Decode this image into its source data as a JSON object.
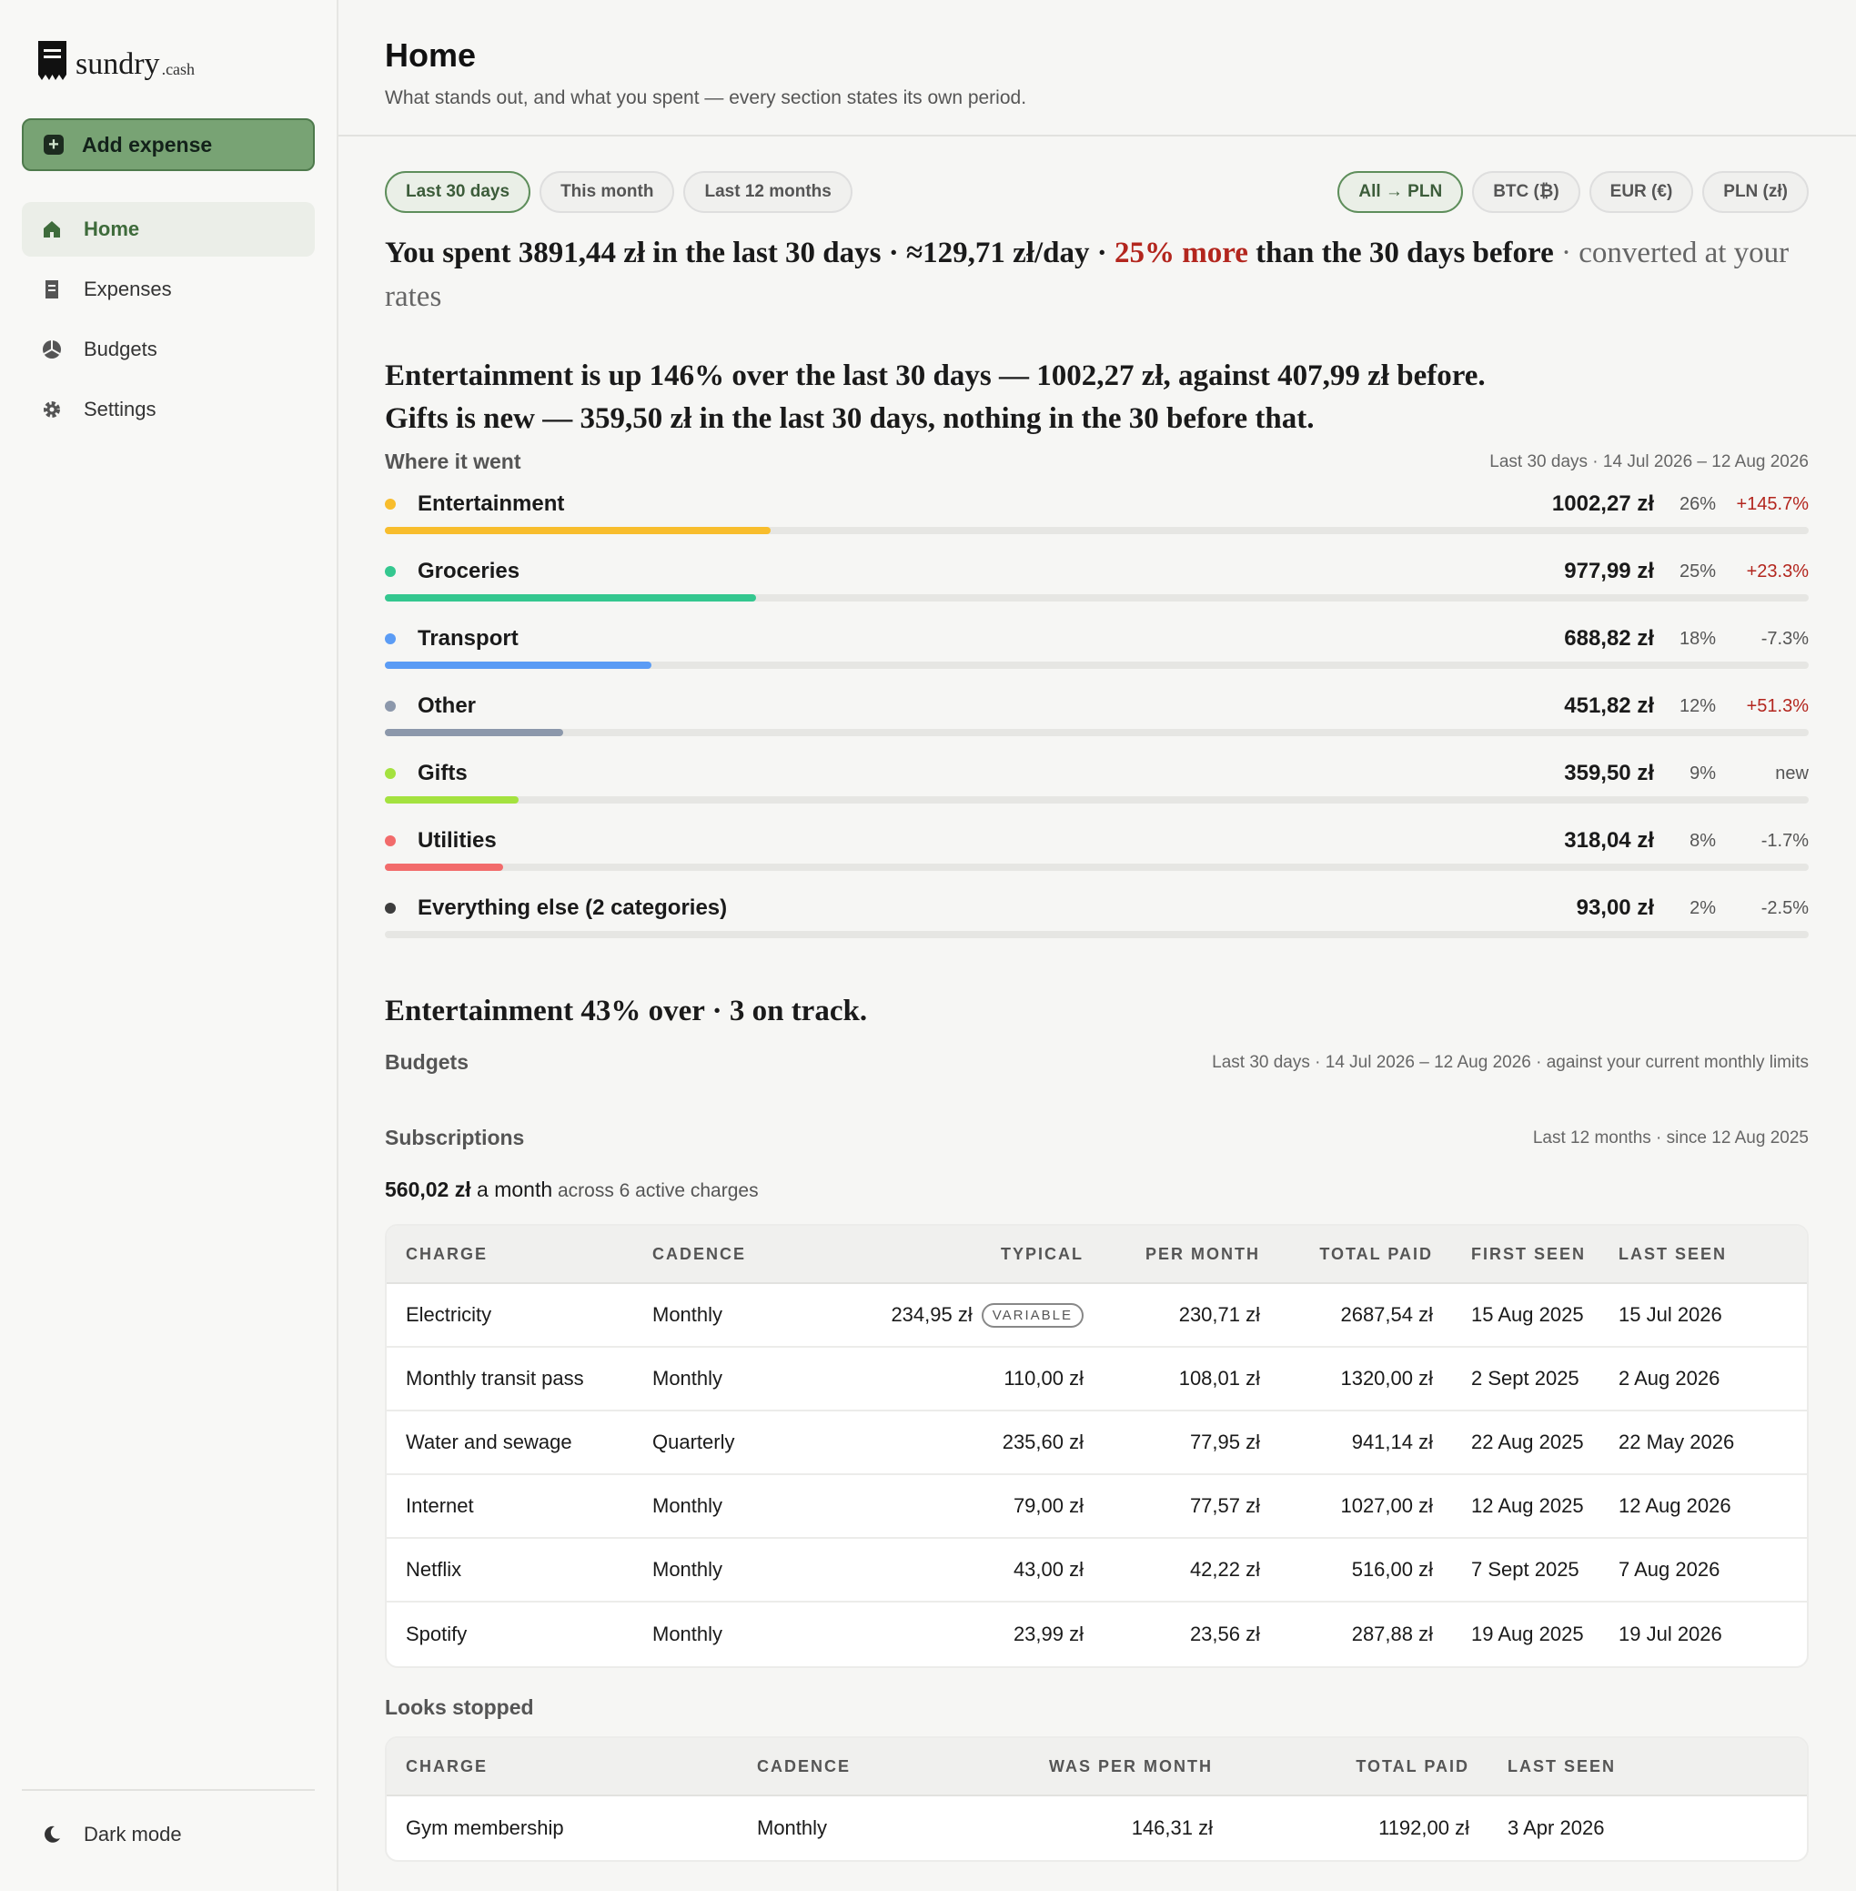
{
  "brand": {
    "name": "sundry",
    "tld": ".cash"
  },
  "sidebar": {
    "add_label": "Add expense",
    "items": [
      {
        "label": "Home",
        "icon": "home-icon"
      },
      {
        "label": "Expenses",
        "icon": "receipt-icon"
      },
      {
        "label": "Budgets",
        "icon": "pie-icon"
      },
      {
        "label": "Settings",
        "icon": "gear-icon"
      }
    ],
    "dark_mode": "Dark mode"
  },
  "header": {
    "title": "Home",
    "subtitle": "What stands out, and what you spent — every section states its own period."
  },
  "period_pills": [
    "Last 30 days",
    "This month",
    "Last 12 months"
  ],
  "currency_pills": [
    "All → PLN",
    "BTC (₿)",
    "EUR (€)",
    "PLN (zł)"
  ],
  "summary": {
    "s1": "You spent ",
    "total": "3891,44 zł",
    "s2": " in the last 30 days · ",
    "per_day": "≈129,71 zł/day",
    "s3": " · ",
    "change": "25% more",
    "s4": " than the 30 days before",
    "s5": " · converted at your rates"
  },
  "headline": {
    "line1": "Entertainment is up 146% over the last 30 days — 1002,27 zł, against 407,99 zł before.",
    "line2": "Gifts is new — 359,50 zł in the last 30 days, nothing in the 30 before that."
  },
  "where": {
    "title": "Where it went",
    "meta": "Last 30 days · 14 Jul 2026 – 12 Aug 2026",
    "categories": [
      {
        "name": "Entertainment",
        "amount": "1002,27 zł",
        "pct": "26%",
        "change": "+145.7%",
        "dir": "up",
        "color": "#f8bd2c",
        "share": 0.26
      },
      {
        "name": "Groceries",
        "amount": "977,99 zł",
        "pct": "25%",
        "change": "+23.3%",
        "dir": "up",
        "color": "#34c78f",
        "share": 0.25
      },
      {
        "name": "Transport",
        "amount": "688,82 zł",
        "pct": "18%",
        "change": "-7.3%",
        "dir": "down",
        "color": "#5b9cf5",
        "share": 0.18
      },
      {
        "name": "Other",
        "amount": "451,82 zł",
        "pct": "12%",
        "change": "+51.3%",
        "dir": "up",
        "color": "#8c98ab",
        "share": 0.12
      },
      {
        "name": "Gifts",
        "amount": "359,50 zł",
        "pct": "9%",
        "change": "new",
        "dir": "down",
        "color": "#a4e23f",
        "share": 0.09
      },
      {
        "name": "Utilities",
        "amount": "318,04 zł",
        "pct": "8%",
        "change": "-1.7%",
        "dir": "down",
        "color": "#f26b6b",
        "share": 0.08
      },
      {
        "name": "Everything else (2 categories)",
        "amount": "93,00 zł",
        "pct": "2%",
        "change": "-2.5%",
        "dir": "down",
        "color": "#3d3d3d",
        "share": 0.0
      }
    ]
  },
  "budgets": {
    "headline": "Entertainment 43% over · 3 on track.",
    "title": "Budgets",
    "meta": "Last 30 days · 14 Jul 2026 – 12 Aug 2026 · against your current monthly limits"
  },
  "subscriptions": {
    "title": "Subscriptions",
    "meta": "Last 12 months · since 12 Aug 2025",
    "total": "560,02 zł",
    "total_unit": " a month",
    "total_note": " across 6 active charges",
    "columns": [
      "CHARGE",
      "CADENCE",
      "TYPICAL",
      "PER MONTH",
      "TOTAL PAID",
      "FIRST SEEN",
      "LAST SEEN"
    ],
    "rows": [
      {
        "charge": "Electricity",
        "cadence": "Monthly",
        "typical": "234,95 zł",
        "badge": "VARIABLE",
        "per_month": "230,71 zł",
        "total": "2687,54 zł",
        "first": "15 Aug 2025",
        "last": "15 Jul 2026"
      },
      {
        "charge": "Monthly transit pass",
        "cadence": "Monthly",
        "typical": "110,00 zł",
        "badge": "",
        "per_month": "108,01 zł",
        "total": "1320,00 zł",
        "first": "2 Sept 2025",
        "last": "2 Aug 2026"
      },
      {
        "charge": "Water and sewage",
        "cadence": "Quarterly",
        "typical": "235,60 zł",
        "badge": "",
        "per_month": "77,95 zł",
        "total": "941,14 zł",
        "first": "22 Aug 2025",
        "last": "22 May 2026"
      },
      {
        "charge": "Internet",
        "cadence": "Monthly",
        "typical": "79,00 zł",
        "badge": "",
        "per_month": "77,57 zł",
        "total": "1027,00 zł",
        "first": "12 Aug 2025",
        "last": "12 Aug 2026"
      },
      {
        "charge": "Netflix",
        "cadence": "Monthly",
        "typical": "43,00 zł",
        "badge": "",
        "per_month": "42,22 zł",
        "total": "516,00 zł",
        "first": "7 Sept 2025",
        "last": "7 Aug 2026"
      },
      {
        "charge": "Spotify",
        "cadence": "Monthly",
        "typical": "23,99 zł",
        "badge": "",
        "per_month": "23,56 zł",
        "total": "287,88 zł",
        "first": "19 Aug 2025",
        "last": "19 Jul 2026"
      }
    ]
  },
  "stopped": {
    "title": "Looks stopped",
    "columns": [
      "CHARGE",
      "CADENCE",
      "WAS PER MONTH",
      "TOTAL PAID",
      "LAST SEEN"
    ],
    "rows": [
      {
        "charge": "Gym membership",
        "cadence": "Monthly",
        "was": "146,31 zł",
        "total": "1192,00 zł",
        "last": "3 Apr 2026"
      }
    ]
  }
}
